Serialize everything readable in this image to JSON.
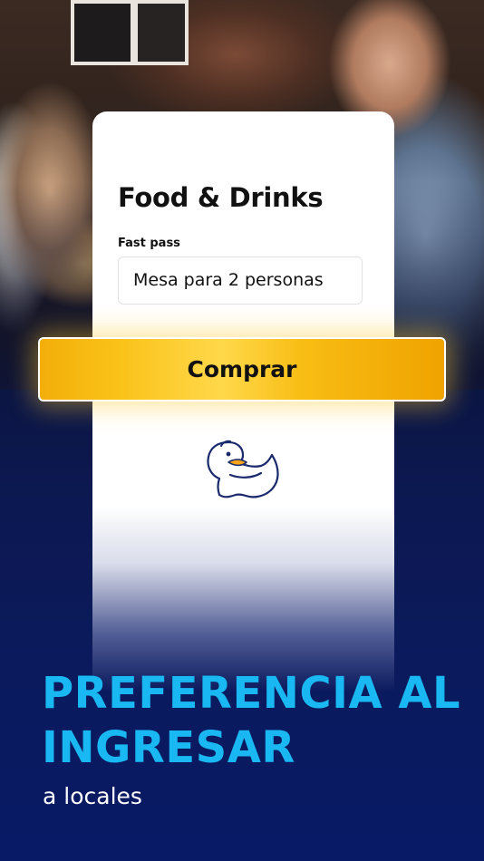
{
  "card": {
    "title": "Food & Drinks",
    "field_label": "Fast pass",
    "field_value": "Mesa para 2 personas"
  },
  "buy_button": {
    "label": "Comprar"
  },
  "logo": {
    "icon": "duck-icon"
  },
  "headline": {
    "line1": "PREFERENCIA AL",
    "line2": "INGRESAR",
    "subline": "a locales"
  },
  "colors": {
    "headline": "#19b8f2",
    "background": "#0b1a5c",
    "button": "#fac31a"
  }
}
